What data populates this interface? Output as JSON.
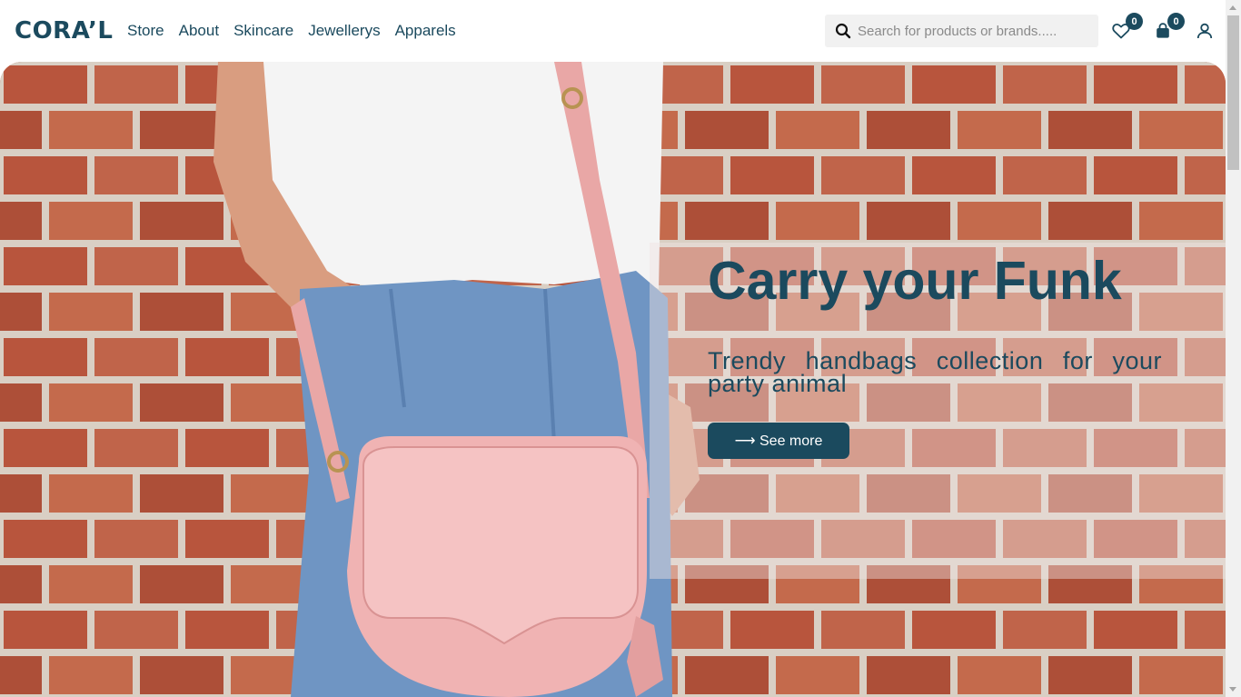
{
  "brand": {
    "logo_text": "CORA’L"
  },
  "nav": [
    {
      "label": "Store"
    },
    {
      "label": "About"
    },
    {
      "label": "Skincare"
    },
    {
      "label": "Jewellerys"
    },
    {
      "label": "Apparels"
    }
  ],
  "search": {
    "placeholder": "Search for products or brands.....",
    "value": ""
  },
  "wishlist": {
    "count": "0",
    "icon": "heart-icon"
  },
  "cart": {
    "count": "0",
    "icon": "shopping-bag-icon"
  },
  "account": {
    "icon": "user-icon"
  },
  "hero": {
    "title": "Carry your Funk",
    "subtitle": "Trendy handbags collection for your party animal",
    "button_label": "⟶ See more"
  },
  "colors": {
    "brand": "#1b4a5e",
    "brick": "#b6573f",
    "mortar": "#d9cfc4",
    "bag": "#f0b3b3"
  }
}
